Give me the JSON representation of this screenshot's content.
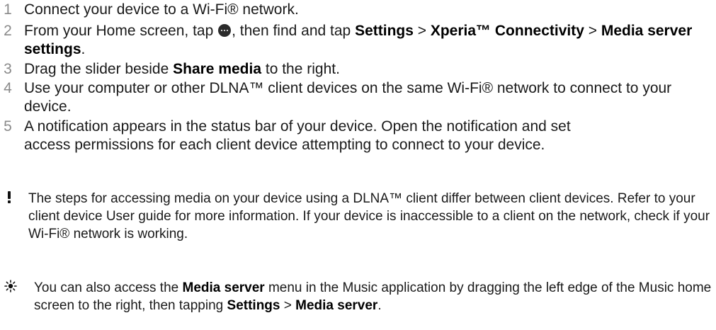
{
  "steps": [
    {
      "number": "1",
      "text": "Connect your device to a Wi-Fi® network."
    },
    {
      "number": "2",
      "pre": "From your Home screen, tap ",
      "icon": "apps-icon",
      "mid1": ", then find and tap ",
      "b1": "Settings",
      "sep1": " > ",
      "b2": "Xperia™ Connectivity",
      "sep2": " > ",
      "b3": "Media server settings",
      "end": "."
    },
    {
      "number": "3",
      "pre": "Drag the slider beside ",
      "b1": "Share media",
      "end": " to the right."
    },
    {
      "number": "4",
      "text": "Use your computer or other DLNA™ client devices on the same Wi-Fi® network to connect to your device."
    },
    {
      "number": "5",
      "text": "A notification appears in the status bar of your device. Open the notification and set access permissions for each client device attempting to connect to your device."
    }
  ],
  "important_note": {
    "icon": "exclamation-icon",
    "text": "The steps for accessing media on your device using a DLNA™ client differ between client devices. Refer to your client device User guide for more information. If your device is inaccessible to a client on the network, check if your Wi-Fi® network is working."
  },
  "tip_note": {
    "icon": "lightbulb-icon",
    "pre": "You can also access the ",
    "b1": "Media server",
    "mid": " menu in the Music application by dragging the left edge of the Music home screen to the right, then tapping ",
    "b2": "Settings",
    "sep": " > ",
    "b3": "Media server",
    "end": "."
  }
}
